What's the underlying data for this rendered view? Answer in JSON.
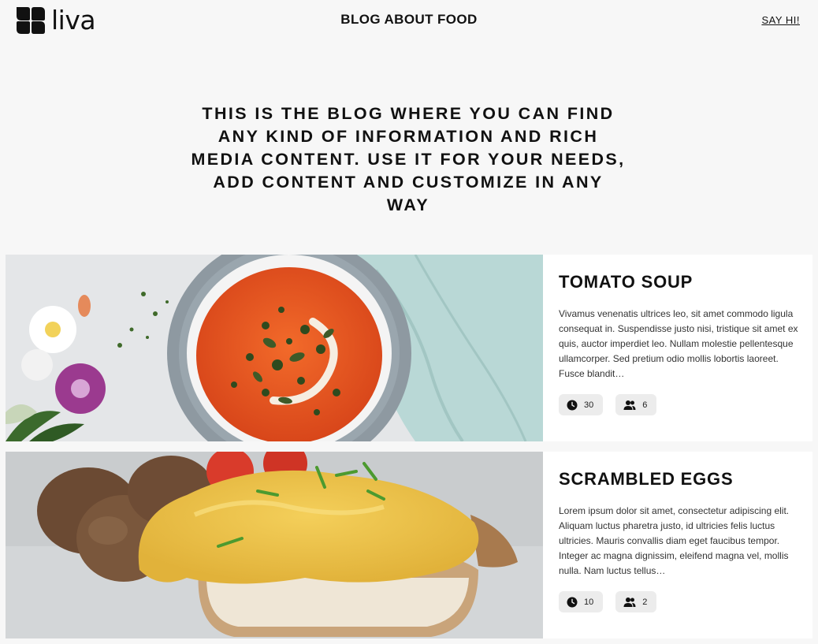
{
  "header": {
    "logo_text": "liva",
    "title": "BLOG ABOUT FOOD",
    "cta_link": "SAY HI!"
  },
  "hero": {
    "text": "THIS IS THE BLOG WHERE YOU CAN FIND ANY KIND OF INFORMATION AND RICH MEDIA CONTENT. USE IT FOR YOUR NEEDS, ADD CONTENT AND CUSTOMIZE IN ANY WAY"
  },
  "posts": [
    {
      "title": "TOMATO SOUP",
      "excerpt": "Vivamus venenatis ultrices leo, sit amet commodo ligula consequat in. Suspendisse justo nisi, tristique sit amet ex quis, auctor imperdiet leo. Nullam molestie pellentesque ullamcorper. Sed pretium odio mollis lobortis laoreet. Fusce blandit…",
      "time": "30",
      "servings": "6",
      "time_icon": "clock-icon",
      "servings_icon": "people-icon"
    },
    {
      "title": "SCRAMBLED EGGS",
      "excerpt": "Lorem ipsum dolor sit amet, consectetur adipiscing elit. Aliquam luctus pharetra justo, id ultricies felis luctus ultricies. Mauris convallis diam eget faucibus tempor. Integer ac magna dignissim, eleifend magna vel, mollis nulla. Nam luctus tellus…",
      "time": "10",
      "servings": "2",
      "time_icon": "clock-icon",
      "servings_icon": "people-icon"
    }
  ]
}
